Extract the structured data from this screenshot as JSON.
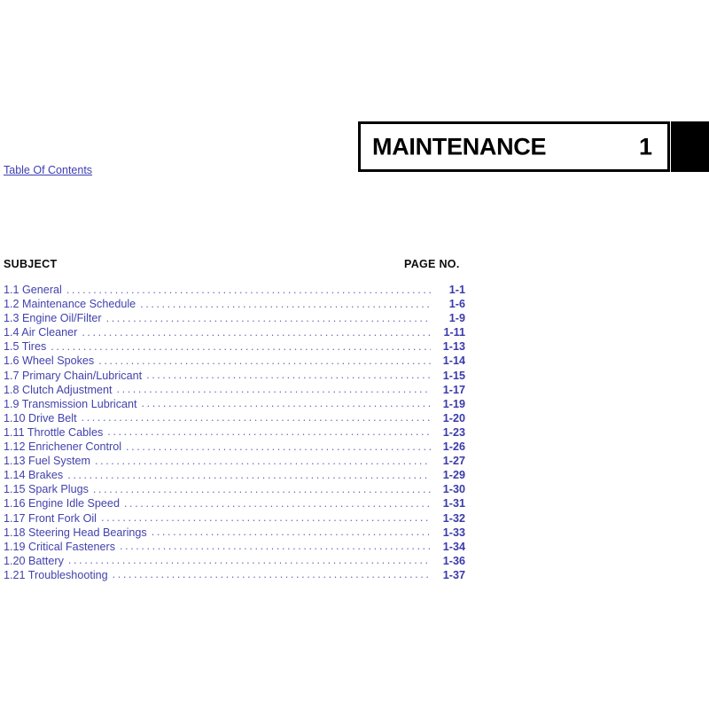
{
  "chapter": {
    "title": "MAINTENANCE",
    "number": "1",
    "tab_color": "#000000"
  },
  "nav": {
    "toc_link_label": "Table Of Contents"
  },
  "columns": {
    "subject_heading": "SUBJECT",
    "page_heading": "PAGE  NO."
  },
  "colors": {
    "link_blue": "#3d3db5",
    "entry_blue": "#4242ad",
    "page_blue": "#3a3aab",
    "leader_blue": "#6868bd",
    "heading_black": "#0b0b0b"
  },
  "toc": {
    "entries": [
      {
        "label": "1.1 General",
        "page": "1-1"
      },
      {
        "label": "1.2 Maintenance Schedule",
        "page": "1-6"
      },
      {
        "label": "1.3 Engine Oil/Filter",
        "page": "1-9"
      },
      {
        "label": "1.4 Air Cleaner",
        "page": "1-11"
      },
      {
        "label": "1.5 Tires",
        "page": "1-13"
      },
      {
        "label": "1.6 Wheel Spokes",
        "page": "1-14"
      },
      {
        "label": "1.7 Primary Chain/Lubricant",
        "page": "1-15"
      },
      {
        "label": "1.8 Clutch Adjustment",
        "page": "1-17"
      },
      {
        "label": "1.9 Transmission Lubricant",
        "page": "1-19"
      },
      {
        "label": "1.10 Drive Belt",
        "page": "1-20"
      },
      {
        "label": "1.11 Throttle Cables",
        "page": "1-23"
      },
      {
        "label": "1.12 Enrichener Control",
        "page": "1-26"
      },
      {
        "label": "1.13 Fuel System",
        "page": "1-27"
      },
      {
        "label": "1.14 Brakes",
        "page": "1-29"
      },
      {
        "label": "1.15 Spark Plugs",
        "page": "1-30"
      },
      {
        "label": "1.16 Engine Idle Speed",
        "page": "1-31"
      },
      {
        "label": "1.17 Front Fork Oil",
        "page": "1-32"
      },
      {
        "label": "1.18 Steering Head Bearings",
        "page": "1-33"
      },
      {
        "label": "1.19 Critical Fasteners",
        "page": "1-34"
      },
      {
        "label": "1.20 Battery",
        "page": "1-36"
      },
      {
        "label": "1.21 Troubleshooting",
        "page": "1-37"
      }
    ]
  }
}
